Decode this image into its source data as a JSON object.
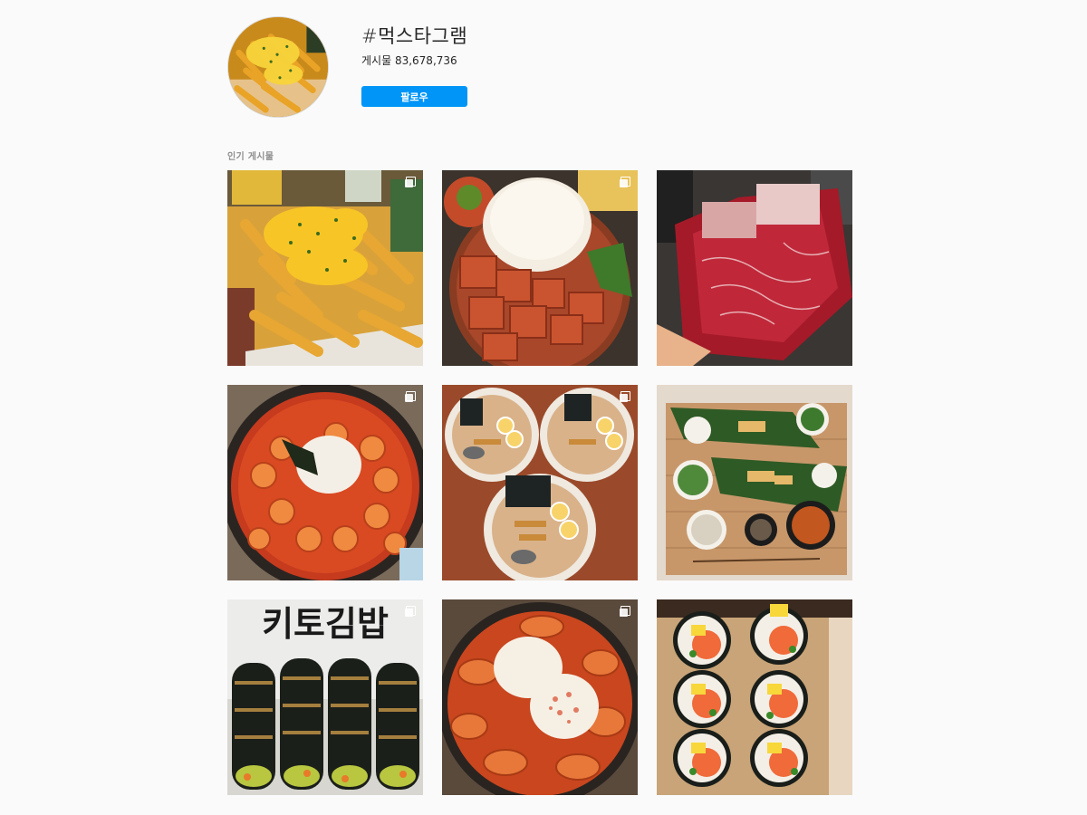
{
  "header": {
    "hashtag": "#먹스타그램",
    "post_count_label": "게시물",
    "post_count": "83,678,736",
    "follow_label": "팔로우"
  },
  "section": {
    "label": "인기 게시물"
  },
  "posts": [
    {
      "name": "post-cheese-fries",
      "multi": true,
      "icon": "multiple-images-icon"
    },
    {
      "name": "post-tofu-rice",
      "multi": true,
      "icon": "multiple-images-icon"
    },
    {
      "name": "post-beef",
      "multi": false
    },
    {
      "name": "post-shrimp-stew",
      "multi": true,
      "icon": "multiple-images-icon"
    },
    {
      "name": "post-ramen",
      "multi": true,
      "icon": "multiple-images-icon"
    },
    {
      "name": "post-table-spread",
      "multi": false
    },
    {
      "name": "post-keto-kimbap",
      "multi": true,
      "icon": "multiple-images-icon",
      "sign_text": "키토김밥"
    },
    {
      "name": "post-chicken-stew",
      "multi": true,
      "icon": "multiple-images-icon"
    },
    {
      "name": "post-sushi-rolls",
      "multi": false
    }
  ],
  "colors": {
    "accent": "#0095f6",
    "background": "#fafafa",
    "muted": "#8e8e8e"
  }
}
